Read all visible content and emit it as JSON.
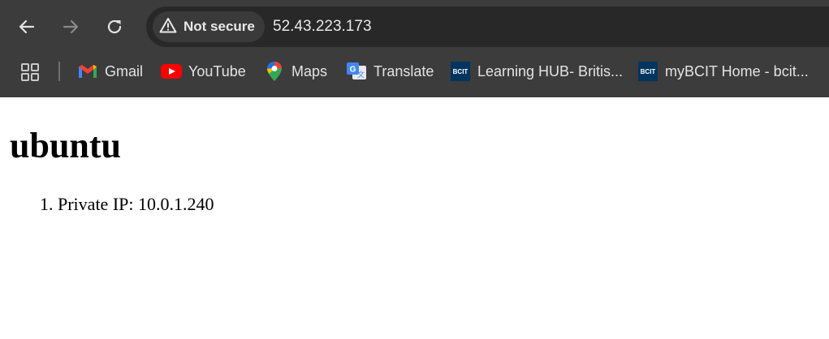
{
  "browser": {
    "security_label": "Not secure",
    "url": "52.43.223.173",
    "icons": {
      "back": "arrow-left-icon",
      "forward": "arrow-right-icon",
      "reload": "reload-icon",
      "security": "warning-triangle-icon",
      "apps": "apps-grid-icon"
    },
    "colors": {
      "toolbar": "#3c3c3c",
      "omnibox": "#282828",
      "text": "#e3e3e3"
    }
  },
  "bookmarks": [
    {
      "label": "Gmail",
      "icon": "gmail-icon"
    },
    {
      "label": "YouTube",
      "icon": "youtube-icon"
    },
    {
      "label": "Maps",
      "icon": "maps-icon"
    },
    {
      "label": "Translate",
      "icon": "translate-icon"
    },
    {
      "label": "Learning HUB- Britis...",
      "icon": "bcit-icon"
    },
    {
      "label": "myBCIT Home - bcit...",
      "icon": "bcit-icon"
    }
  ],
  "page": {
    "title": "ubuntu",
    "list": [
      {
        "number": "1.",
        "text": "Private IP: 10.0.1.240"
      }
    ]
  }
}
